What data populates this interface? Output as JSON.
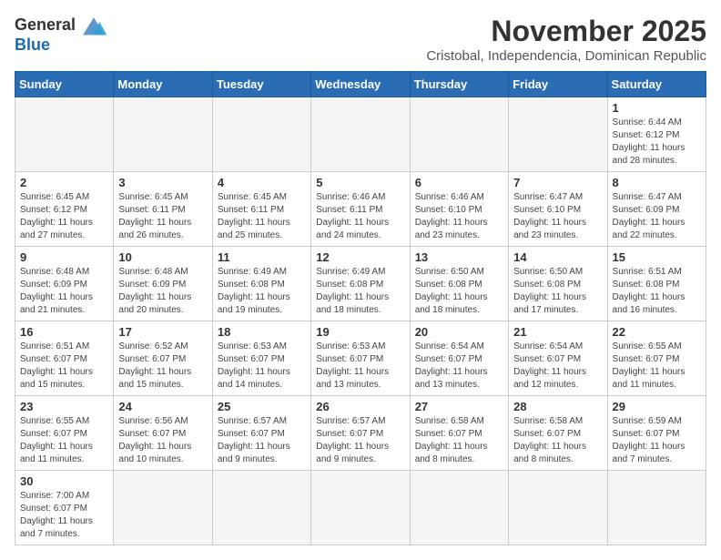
{
  "header": {
    "logo_general": "General",
    "logo_blue": "Blue",
    "month_title": "November 2025",
    "subtitle": "Cristobal, Independencia, Dominican Republic"
  },
  "days_of_week": [
    "Sunday",
    "Monday",
    "Tuesday",
    "Wednesday",
    "Thursday",
    "Friday",
    "Saturday"
  ],
  "weeks": [
    [
      {
        "day": "",
        "info": ""
      },
      {
        "day": "",
        "info": ""
      },
      {
        "day": "",
        "info": ""
      },
      {
        "day": "",
        "info": ""
      },
      {
        "day": "",
        "info": ""
      },
      {
        "day": "",
        "info": ""
      },
      {
        "day": "1",
        "info": "Sunrise: 6:44 AM\nSunset: 6:12 PM\nDaylight: 11 hours\nand 28 minutes."
      }
    ],
    [
      {
        "day": "2",
        "info": "Sunrise: 6:45 AM\nSunset: 6:12 PM\nDaylight: 11 hours\nand 27 minutes."
      },
      {
        "day": "3",
        "info": "Sunrise: 6:45 AM\nSunset: 6:11 PM\nDaylight: 11 hours\nand 26 minutes."
      },
      {
        "day": "4",
        "info": "Sunrise: 6:45 AM\nSunset: 6:11 PM\nDaylight: 11 hours\nand 25 minutes."
      },
      {
        "day": "5",
        "info": "Sunrise: 6:46 AM\nSunset: 6:11 PM\nDaylight: 11 hours\nand 24 minutes."
      },
      {
        "day": "6",
        "info": "Sunrise: 6:46 AM\nSunset: 6:10 PM\nDaylight: 11 hours\nand 23 minutes."
      },
      {
        "day": "7",
        "info": "Sunrise: 6:47 AM\nSunset: 6:10 PM\nDaylight: 11 hours\nand 23 minutes."
      },
      {
        "day": "8",
        "info": "Sunrise: 6:47 AM\nSunset: 6:09 PM\nDaylight: 11 hours\nand 22 minutes."
      }
    ],
    [
      {
        "day": "9",
        "info": "Sunrise: 6:48 AM\nSunset: 6:09 PM\nDaylight: 11 hours\nand 21 minutes."
      },
      {
        "day": "10",
        "info": "Sunrise: 6:48 AM\nSunset: 6:09 PM\nDaylight: 11 hours\nand 20 minutes."
      },
      {
        "day": "11",
        "info": "Sunrise: 6:49 AM\nSunset: 6:08 PM\nDaylight: 11 hours\nand 19 minutes."
      },
      {
        "day": "12",
        "info": "Sunrise: 6:49 AM\nSunset: 6:08 PM\nDaylight: 11 hours\nand 18 minutes."
      },
      {
        "day": "13",
        "info": "Sunrise: 6:50 AM\nSunset: 6:08 PM\nDaylight: 11 hours\nand 18 minutes."
      },
      {
        "day": "14",
        "info": "Sunrise: 6:50 AM\nSunset: 6:08 PM\nDaylight: 11 hours\nand 17 minutes."
      },
      {
        "day": "15",
        "info": "Sunrise: 6:51 AM\nSunset: 6:08 PM\nDaylight: 11 hours\nand 16 minutes."
      }
    ],
    [
      {
        "day": "16",
        "info": "Sunrise: 6:51 AM\nSunset: 6:07 PM\nDaylight: 11 hours\nand 15 minutes."
      },
      {
        "day": "17",
        "info": "Sunrise: 6:52 AM\nSunset: 6:07 PM\nDaylight: 11 hours\nand 15 minutes."
      },
      {
        "day": "18",
        "info": "Sunrise: 6:53 AM\nSunset: 6:07 PM\nDaylight: 11 hours\nand 14 minutes."
      },
      {
        "day": "19",
        "info": "Sunrise: 6:53 AM\nSunset: 6:07 PM\nDaylight: 11 hours\nand 13 minutes."
      },
      {
        "day": "20",
        "info": "Sunrise: 6:54 AM\nSunset: 6:07 PM\nDaylight: 11 hours\nand 13 minutes."
      },
      {
        "day": "21",
        "info": "Sunrise: 6:54 AM\nSunset: 6:07 PM\nDaylight: 11 hours\nand 12 minutes."
      },
      {
        "day": "22",
        "info": "Sunrise: 6:55 AM\nSunset: 6:07 PM\nDaylight: 11 hours\nand 11 minutes."
      }
    ],
    [
      {
        "day": "23",
        "info": "Sunrise: 6:55 AM\nSunset: 6:07 PM\nDaylight: 11 hours\nand 11 minutes."
      },
      {
        "day": "24",
        "info": "Sunrise: 6:56 AM\nSunset: 6:07 PM\nDaylight: 11 hours\nand 10 minutes."
      },
      {
        "day": "25",
        "info": "Sunrise: 6:57 AM\nSunset: 6:07 PM\nDaylight: 11 hours\nand 9 minutes."
      },
      {
        "day": "26",
        "info": "Sunrise: 6:57 AM\nSunset: 6:07 PM\nDaylight: 11 hours\nand 9 minutes."
      },
      {
        "day": "27",
        "info": "Sunrise: 6:58 AM\nSunset: 6:07 PM\nDaylight: 11 hours\nand 8 minutes."
      },
      {
        "day": "28",
        "info": "Sunrise: 6:58 AM\nSunset: 6:07 PM\nDaylight: 11 hours\nand 8 minutes."
      },
      {
        "day": "29",
        "info": "Sunrise: 6:59 AM\nSunset: 6:07 PM\nDaylight: 11 hours\nand 7 minutes."
      }
    ],
    [
      {
        "day": "30",
        "info": "Sunrise: 7:00 AM\nSunset: 6:07 PM\nDaylight: 11 hours\nand 7 minutes."
      },
      {
        "day": "",
        "info": ""
      },
      {
        "day": "",
        "info": ""
      },
      {
        "day": "",
        "info": ""
      },
      {
        "day": "",
        "info": ""
      },
      {
        "day": "",
        "info": ""
      },
      {
        "day": "",
        "info": ""
      }
    ]
  ]
}
